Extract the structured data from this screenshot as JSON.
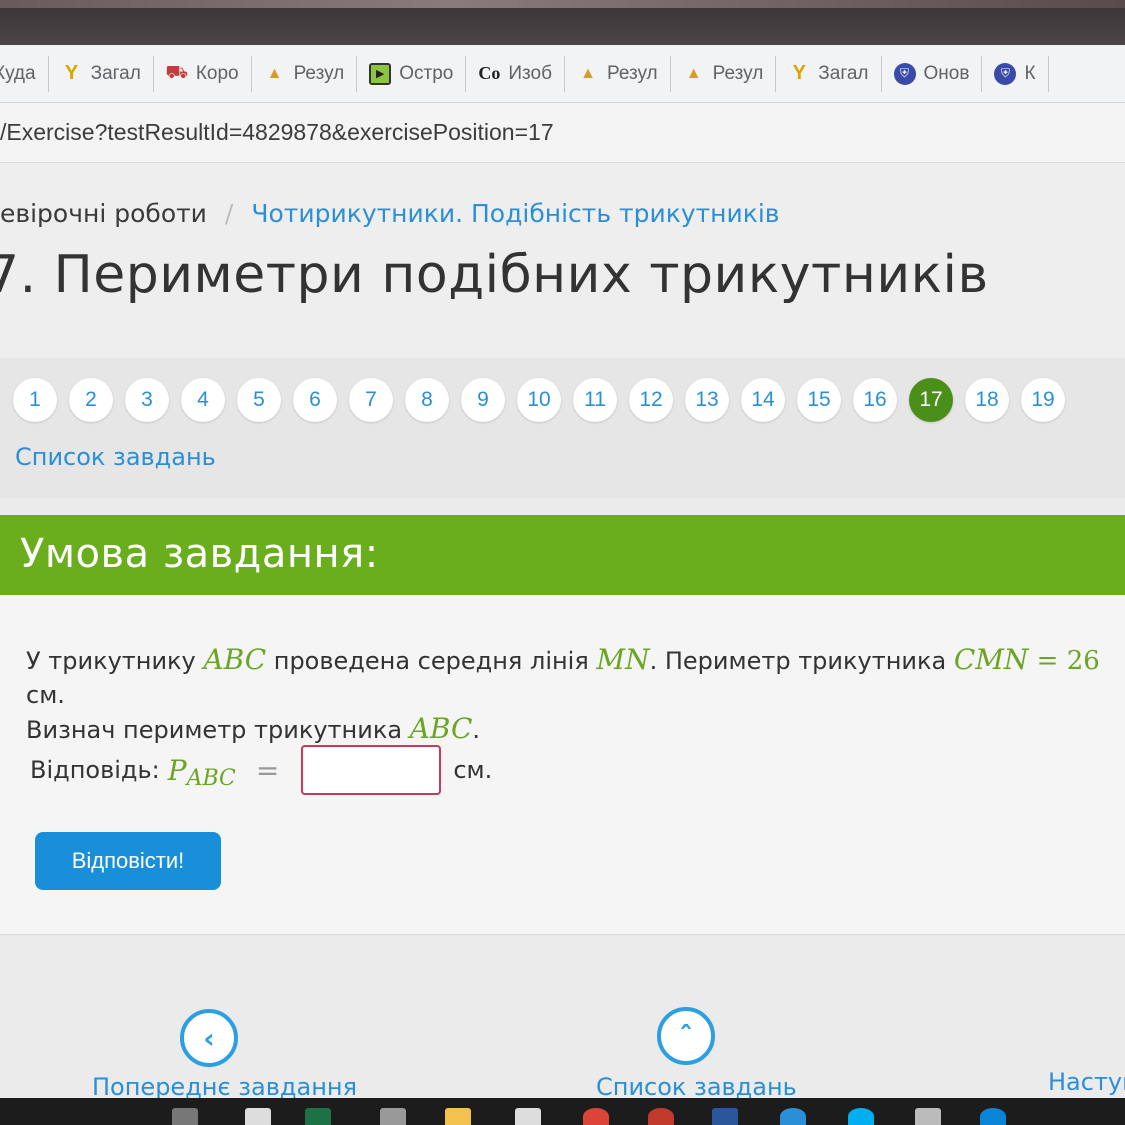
{
  "bookmarks": [
    {
      "label": "Куда",
      "icon": "none"
    },
    {
      "label": "Загал",
      "icon": "funnel-icon"
    },
    {
      "label": "Коро",
      "icon": "cart-icon"
    },
    {
      "label": "Резул",
      "icon": "bell-icon"
    },
    {
      "label": "Остро",
      "icon": "play-icon"
    },
    {
      "label": "Изоб",
      "icon": "co-icon"
    },
    {
      "label": "Резул",
      "icon": "bell-icon"
    },
    {
      "label": "Резул",
      "icon": "bell-icon"
    },
    {
      "label": "Загал",
      "icon": "funnel-icon"
    },
    {
      "label": "Онов",
      "icon": "shield-icon"
    },
    {
      "label": "К",
      "icon": "shield-icon"
    }
  ],
  "bookmark_icon_glyphs": {
    "funnel": "Y",
    "cart": "⛟",
    "bell": "▲",
    "play": "▶",
    "co": "Co",
    "shield": "⛨"
  },
  "url": "/Exercise?testResultId=4829878&exercisePosition=17",
  "breadcrumb": {
    "parent": "евірочні роботи",
    "separator": "/",
    "current": "Чотирикутники. Подібність трикутників"
  },
  "page_title": "7. Периметри подібних трикутників",
  "pager": {
    "pages": [
      "1",
      "2",
      "3",
      "4",
      "5",
      "6",
      "7",
      "8",
      "9",
      "10",
      "11",
      "12",
      "13",
      "14",
      "15",
      "16",
      "17",
      "18",
      "19"
    ],
    "active": "17"
  },
  "task_list_link": "Список завдань",
  "condition_title": "Умова завдання:",
  "problem": {
    "t1": "У трикутнику ",
    "m1": "ABC",
    "t2": " проведена середня лінія ",
    "m2": "MN",
    "t3": ". Периметр трикутника ",
    "m3": "CMN",
    "eq": " = ",
    "num": "26",
    "t4": " см.",
    "t5": "Визнач периметр трикутника ",
    "m4": "ABC",
    "t6": "."
  },
  "answer": {
    "label": "Відповідь: ",
    "var": "P",
    "sub": "ABC",
    "eq": "=",
    "value": "",
    "unit": "см."
  },
  "submit_label": "Відповісти!",
  "footer": {
    "prev_label": "Попереднє завдання",
    "list_label": "Список завдань",
    "next_label": "Наступ"
  },
  "colors": {
    "accent_green": "#6aad1d",
    "active_page": "#4a8f18",
    "link_blue": "#2b8fd6",
    "button_blue": "#1a8fd9",
    "math_green": "#6aa526",
    "input_border": "#c8385f"
  }
}
